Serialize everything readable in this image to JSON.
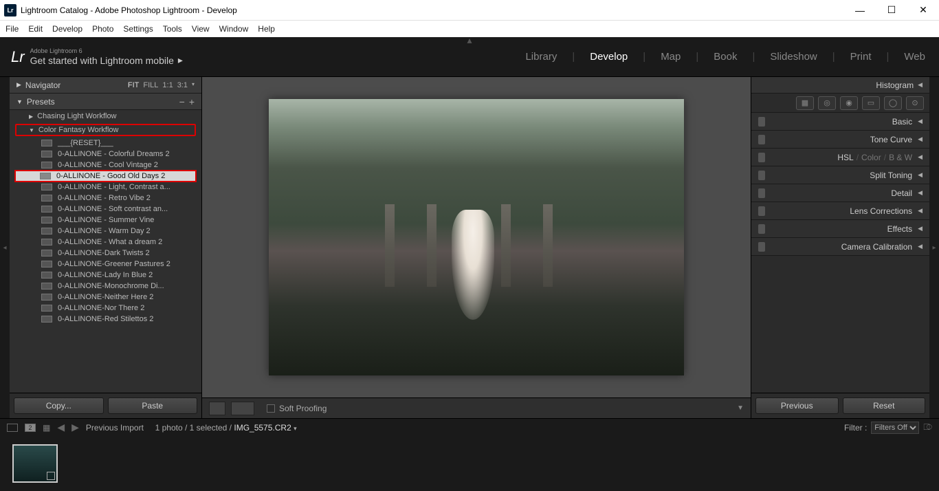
{
  "titlebar": {
    "title": "Lightroom Catalog - Adobe Photoshop Lightroom - Develop"
  },
  "menubar": [
    "File",
    "Edit",
    "Develop",
    "Photo",
    "Settings",
    "Tools",
    "View",
    "Window",
    "Help"
  ],
  "brand": {
    "sub": "Adobe Lightroom 6",
    "main": "Get started with Lightroom mobile"
  },
  "modules": [
    "Library",
    "Develop",
    "Map",
    "Book",
    "Slideshow",
    "Print",
    "Web"
  ],
  "activeModule": "Develop",
  "navigator": {
    "title": "Navigator",
    "opts": [
      "FIT",
      "FILL",
      "1:1",
      "3:1"
    ]
  },
  "presetsPanel": {
    "title": "Presets"
  },
  "folders": [
    {
      "name": "Chasing Light Workflow",
      "open": false,
      "highlight": false
    },
    {
      "name": "Color Fantasy Workflow",
      "open": true,
      "highlight": true
    }
  ],
  "presets": [
    "___{RESET}___",
    "0-ALLINONE - Colorful Dreams 2",
    "0-ALLINONE - Cool Vintage 2",
    "0-ALLINONE - Good Old Days 2",
    "0-ALLINONE - Light, Contrast a...",
    "0-ALLINONE - Retro Vibe 2",
    "0-ALLINONE - Soft contrast an...",
    "0-ALLINONE - Summer Vine",
    "0-ALLINONE - Warm Day 2",
    "0-ALLINONE - What a dream 2",
    "0-ALLINONE-Dark Twists 2",
    "0-ALLINONE-Greener Pastures 2",
    "0-ALLINONE-Lady In Blue 2",
    "0-ALLINONE-Monochrome Di...",
    "0-ALLINONE-Neither Here 2",
    "0-ALLINONE-Nor There 2",
    "0-ALLINONE-Red Stilettos 2"
  ],
  "selectedPresetIndex": 3,
  "copyPaste": {
    "copy": "Copy...",
    "paste": "Paste"
  },
  "softProofing": "Soft Proofing",
  "rightPanels": {
    "histogram": "Histogram",
    "sections": [
      "Basic",
      "Tone Curve",
      {
        "compound": [
          "HSL",
          "Color",
          "B & W"
        ]
      },
      "Split Toning",
      "Detail",
      "Lens Corrections",
      "Effects",
      "Camera Calibration"
    ]
  },
  "prevReset": {
    "prev": "Previous",
    "reset": "Reset"
  },
  "filmstripBar": {
    "source": "Previous Import",
    "count": "1 photo / 1 selected /",
    "filename": "IMG_5575.CR2",
    "filterLabel": "Filter :",
    "filterValue": "Filters Off",
    "secondLabel": "2"
  }
}
